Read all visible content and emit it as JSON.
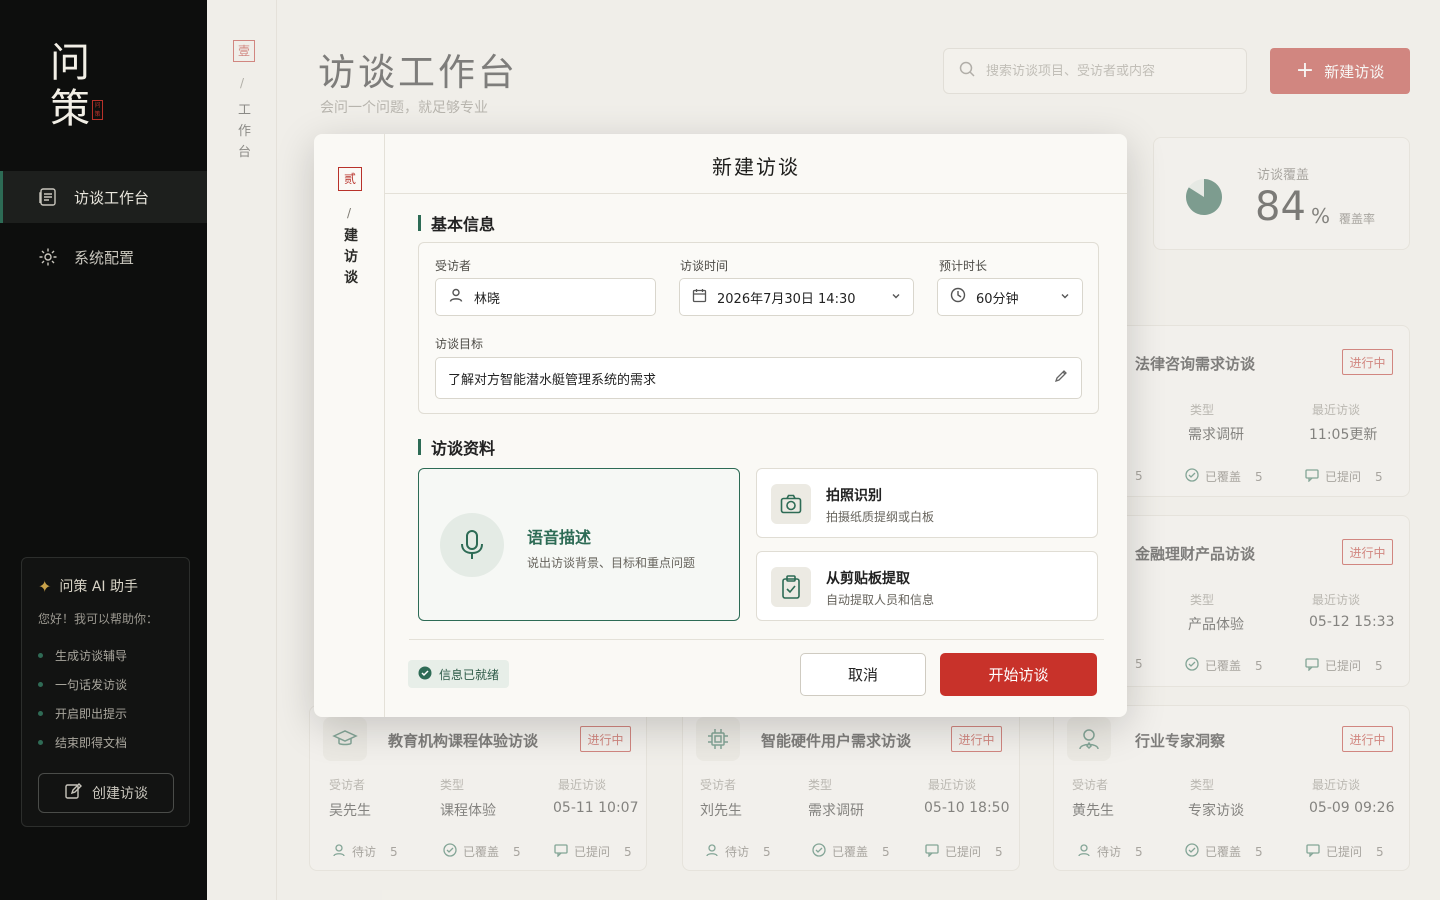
{
  "brand": {
    "logo_line1": "问",
    "logo_line2": "策",
    "seal": "问策"
  },
  "sidebar": {
    "items": [
      {
        "label": "访谈工作台"
      },
      {
        "label": "系统配置"
      }
    ],
    "ai": {
      "title": "问策 AI 助手",
      "greeting": "您好！我可以帮助你：",
      "features": [
        "生成访谈辅导",
        "一句话发访谈",
        "开启即出提示",
        "结束即得文档"
      ],
      "button": "创建访谈"
    }
  },
  "rail": {
    "seal": "壹",
    "slash": "/",
    "text": "工作台"
  },
  "header": {
    "title": "访谈工作台",
    "subtitle": "会问一个问题，就足够专业",
    "search_placeholder": "搜索访谈项目、受访者或内容",
    "new_button": "新建访谈"
  },
  "coverage": {
    "label": "访谈覆盖",
    "value": "84",
    "unit": "%",
    "suffix": "覆盖率",
    "fraction": 0.84
  },
  "labels": {
    "interviewee": "受访者",
    "type": "类型",
    "recent": "最近访谈",
    "pending": "待访",
    "covered": "已覆盖",
    "asked": "已提问"
  },
  "cards": [
    {
      "title": "法律咨询需求访谈",
      "status": "进行中",
      "type": "需求调研",
      "recent": "11:05更新",
      "pending": "5",
      "covered": "5",
      "asked": "5"
    },
    {
      "title": "金融理财产品访谈",
      "status": "进行中",
      "type": "产品体验",
      "recent": "05-12 15:33",
      "pending": "5",
      "covered": "5",
      "asked": "5"
    },
    {
      "title": "教育机构课程体验访谈",
      "status": "进行中",
      "interviewee": "吴先生",
      "type": "课程体验",
      "recent": "05-11 10:07",
      "pending": "5",
      "covered": "5",
      "asked": "5"
    },
    {
      "title": "智能硬件用户需求访谈",
      "status": "进行中",
      "interviewee": "刘先生",
      "type": "需求调研",
      "recent": "05-10 18:50",
      "pending": "5",
      "covered": "5",
      "asked": "5"
    },
    {
      "title": "行业专家洞察",
      "status": "进行中",
      "interviewee": "黄先生",
      "type": "专家访谈",
      "recent": "05-09 09:26",
      "pending": "5",
      "covered": "5",
      "asked": "5"
    }
  ],
  "modal": {
    "seal": "贰",
    "slash": "/",
    "vertical": "建访谈",
    "title": "新建访谈",
    "section_basic": "基本信息",
    "interviewee_label": "受访者",
    "interviewee_value": "林晓",
    "time_label": "访谈时间",
    "time_value": "2026年7月30日 14:30",
    "duration_label": "预计时长",
    "duration_value": "60分钟",
    "goal_label": "访谈目标",
    "goal_value": "了解对方智能潜水艇管理系统的需求",
    "section_material": "访谈资料",
    "voice_title": "语音描述",
    "voice_sub": "说出访谈背景、目标和重点问题",
    "photo_title": "拍照识别",
    "photo_sub": "拍摄纸质提纲或白板",
    "clip_title": "从剪贴板提取",
    "clip_sub": "自动提取人员和信息",
    "ready": "信息已就绪",
    "cancel": "取消",
    "start": "开始访谈"
  },
  "colors": {
    "accent_red": "#b8322a",
    "accent_green": "#2d6b55",
    "sidebar_bg": "#0d0e0d"
  }
}
